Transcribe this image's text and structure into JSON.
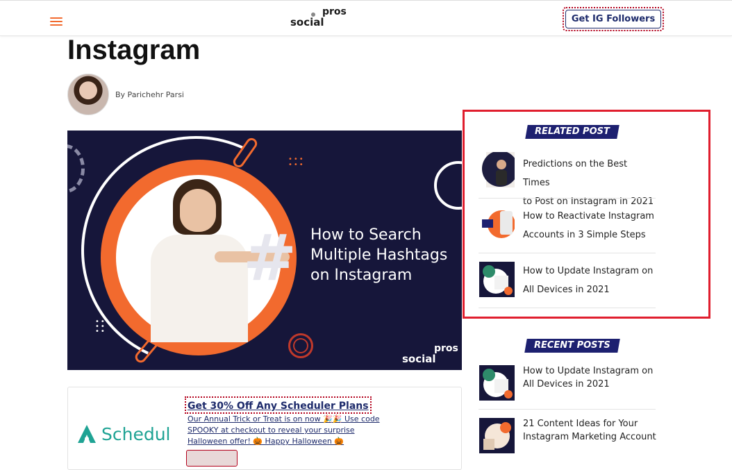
{
  "header": {
    "logo_social": "social",
    "logo_pros": "pros",
    "cta_label": "Get IG Followers"
  },
  "article": {
    "title": "Instagram",
    "author": "By Parichehr Parsi",
    "hero": {
      "line1": "How to Search",
      "line2": "Multiple Hashtags",
      "line3": "on Instagram",
      "hash_glyph": "#",
      "logo_social": "social",
      "logo_pros": "pros"
    }
  },
  "promo": {
    "brand": "Schedul",
    "title": "Get 30% Off Any Scheduler Plans",
    "body": "Our Annual Trick or Treat is on now 🎉🎉 Use code SPOOKY at checkout to reveal your surprise Halloween offer! 🎃 Happy Halloween 🎃"
  },
  "related": {
    "heading": "RELATED POST",
    "items": [
      {
        "line1": "Predictions on the Best Times",
        "line2": "to Post on Instagram in 2021"
      },
      {
        "line1": "How to Reactivate Instagram",
        "line2": "Accounts in 3 Simple Steps"
      },
      {
        "line1": "How to Update Instagram on",
        "line2": "All Devices in 2021"
      }
    ]
  },
  "recent": {
    "heading": "RECENT POSTS",
    "items": [
      {
        "line1": "How to Update Instagram on",
        "line2": "All Devices in 2021"
      },
      {
        "line1": "21 Content Ideas for Your",
        "line2": "Instagram Marketing Account"
      }
    ]
  },
  "colors": {
    "accent_orange": "#f26a2e",
    "navy": "#1d2070",
    "highlight_red": "#e01e2e",
    "hero_bg": "#16163a",
    "brand_teal": "#1fa394"
  }
}
